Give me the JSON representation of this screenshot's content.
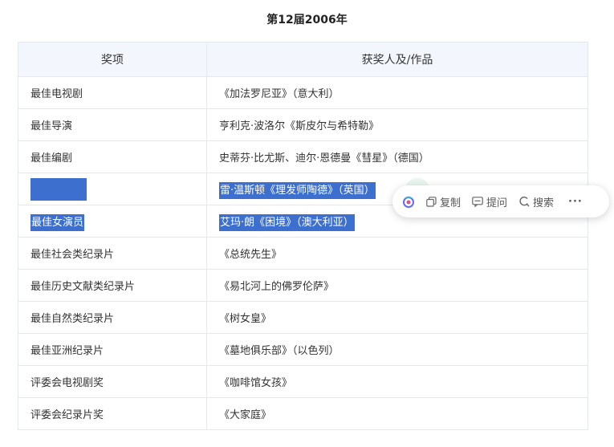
{
  "page": {
    "title": "第12届2006年"
  },
  "table": {
    "headers": [
      "奖项",
      "获奖人及/作品"
    ],
    "rows": [
      {
        "award": "最佳电视剧",
        "winner": "《加法罗尼亚》（意大利）"
      },
      {
        "award": "最佳导演",
        "winner": "亨利克·波洛尔《斯皮尔与希特勒》"
      },
      {
        "award": "最佳编剧",
        "winner": "史蒂芬·比尤斯、迪尔·恩德曼《彗星》（德国）"
      },
      {
        "award": "",
        "winner": "雷·温斯顿《理发师陶德》（英国）"
      },
      {
        "award": "最佳女演员",
        "winner": "艾玛·朗《困境》（澳大利亚）"
      },
      {
        "award": "最佳社会类纪录片",
        "winner": "《总统先生》"
      },
      {
        "award": "最佳历史文献类纪录片",
        "winner": "《易北河上的佛罗伦萨》"
      },
      {
        "award": "最佳自然类纪录片",
        "winner": "《树女皇》"
      },
      {
        "award": "最佳亚洲纪录片",
        "winner": "《墓地俱乐部》（以色列）"
      },
      {
        "award": "评委会电视剧奖",
        "winner": "《咖啡馆女孩》"
      },
      {
        "award": "评委会纪录片奖",
        "winner": "《大家庭》"
      }
    ]
  },
  "toolbar": {
    "copy_label": "复制",
    "ask_label": "提问",
    "search_label": "搜索",
    "more_label": "···",
    "icons": {
      "logo": "assistant-logo-icon",
      "copy": "copy-icon",
      "ask": "ask-icon",
      "search": "search-icon"
    },
    "colors": {
      "selection": "#3d6fcf",
      "header_bg": "#f3f7fd"
    }
  }
}
